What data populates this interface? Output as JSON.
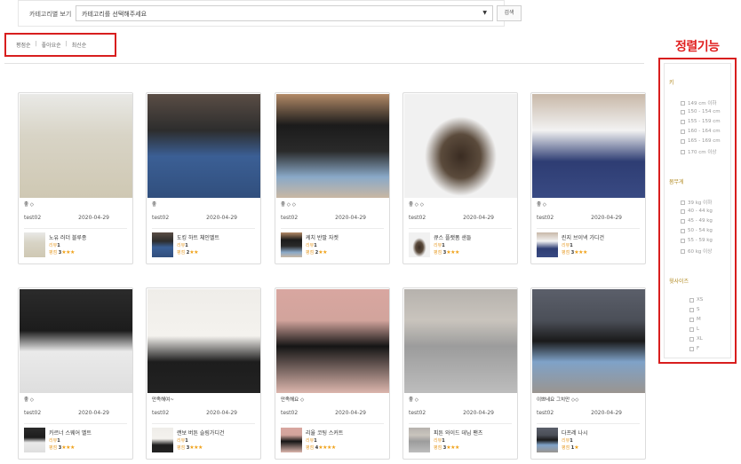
{
  "category_filter": {
    "label": "카테고리별 보기",
    "placeholder": "카테고리를 선택해주세요",
    "caret": "▼",
    "button": "검색"
  },
  "sort": {
    "options": [
      "평점순",
      "좋아요순",
      "최신순"
    ],
    "separator": "|"
  },
  "annotation": "정렬기능",
  "side_filter": {
    "height": {
      "title": "키",
      "options": [
        "149 cm 이하",
        "150 - 154 cm",
        "155 - 159 cm",
        "160 - 164 cm",
        "165 - 169 cm",
        "170 cm 이상"
      ]
    },
    "weight": {
      "title": "몸무게",
      "options": [
        "39 kg 이하",
        "40 - 44 kg",
        "45 - 49 kg",
        "50 - 54 kg",
        "55 - 59 kg",
        "60 kg 이상"
      ]
    },
    "top_size": {
      "title": "윗사이즈",
      "options": [
        "XS",
        "S",
        "M",
        "L",
        "XL",
        "F"
      ]
    }
  },
  "products": [
    {
      "badge": "좋 ◇",
      "user": "test02",
      "date": "2020-04-29",
      "name": "노유 러더 블루종",
      "review_label": "리뷰",
      "review_count": "1",
      "rating_label": "평점",
      "rating_value": "3",
      "stars": "★★★"
    },
    {
      "badge": "좋",
      "user": "test02",
      "date": "2020-04-29",
      "name": "도킹 하트 체인벨트",
      "review_label": "리뷰",
      "review_count": "1",
      "rating_label": "평점",
      "rating_value": "2",
      "stars": "★★"
    },
    {
      "badge": "좋 ◇ ◇",
      "user": "test02",
      "date": "2020-04-29",
      "name": "케치 반팔 자켓",
      "review_label": "리뷰",
      "review_count": "1",
      "rating_label": "평점",
      "rating_value": "2",
      "stars": "★★"
    },
    {
      "badge": "좋 ◇ ◇",
      "user": "test02",
      "date": "2020-04-29",
      "name": "큐스 플랫폼 샌들",
      "review_label": "리뷰",
      "review_count": "1",
      "rating_label": "평점",
      "rating_value": "3",
      "stars": "★★★"
    },
    {
      "badge": "좋 ◇",
      "user": "test02",
      "date": "2020-04-29",
      "name": "린지 브이넥 가디건",
      "review_label": "리뷰",
      "review_count": "1",
      "rating_label": "평점",
      "rating_value": "3",
      "stars": "★★★"
    },
    {
      "badge": "좋 ◇",
      "user": "test02",
      "date": "2020-04-29",
      "name": "카르너 스웨어 벨트",
      "review_label": "리뷰",
      "review_count": "1",
      "rating_label": "평점",
      "rating_value": "3",
      "stars": "★★★"
    },
    {
      "badge": "만족해여~",
      "user": "test02",
      "date": "2020-04-29",
      "name": "랜보 버튼 슬림가디건",
      "review_label": "리뷰",
      "review_count": "1",
      "rating_label": "평점",
      "rating_value": "3",
      "stars": "★★★"
    },
    {
      "badge": "만족해요 ◇",
      "user": "test02",
      "date": "2020-04-29",
      "name": "리율 코팅 스커트",
      "review_label": "리뷰",
      "review_count": "1",
      "rating_label": "평점",
      "rating_value": "4",
      "stars": "★★★★"
    },
    {
      "badge": "좋 ◇",
      "user": "test02",
      "date": "2020-04-29",
      "name": "피튼 와이드 데님 팬츠",
      "review_label": "리뷰",
      "review_count": "1",
      "rating_label": "평점",
      "rating_value": "3",
      "stars": "★★★"
    },
    {
      "badge": "이쁘네요 그치만 ◇◇",
      "user": "test02",
      "date": "2020-04-29",
      "name": "다프레 나시",
      "review_label": "리뷰",
      "review_count": "1",
      "rating_label": "평점",
      "rating_value": "1",
      "stars": "★"
    }
  ],
  "colors": {
    "accent_red": "#d81e1e",
    "star": "#f0a21a",
    "filter_heading": "#b28a22"
  }
}
